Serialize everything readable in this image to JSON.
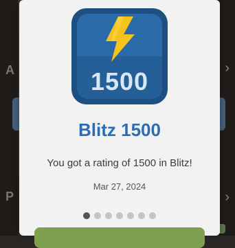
{
  "achievement": {
    "icon_number": "1500",
    "title": "Blitz 1500",
    "message": "You got a rating of 1500 in Blitz!",
    "date": "Mar 27, 2024"
  },
  "carousel": {
    "page_count": 7,
    "active_index": 0
  },
  "background": {
    "fragments": [
      "A",
      "P"
    ]
  },
  "colors": {
    "accent_blue": "#2b6db4",
    "tile_blue": "#2a6aa8",
    "bolt_yellow": "#f6c21c",
    "button_green": "#7ea04f"
  }
}
